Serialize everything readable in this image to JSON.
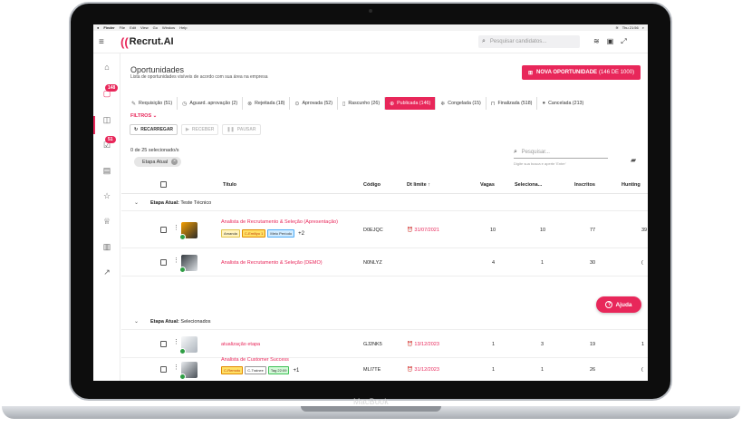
{
  "device": {
    "label": "MacBook"
  },
  "macbar": {
    "items": [
      "Finder",
      "File",
      "Edit",
      "View",
      "Go",
      "Window",
      "Help"
    ],
    "clock": "Thu 21:56"
  },
  "header": {
    "logo_text": "Recrut.AI",
    "search_placeholder": "Pesquisar candidatos..."
  },
  "sidebar": {
    "badges": [
      "148",
      "51"
    ]
  },
  "page": {
    "title": "Oportunidades",
    "subtitle": "Lista de oportunidades visíveis de acordo com sua área na empresa",
    "new_button": "NOVA OPORTUNIDADE",
    "new_button_count": "(146 DE 1000)"
  },
  "tabs": [
    {
      "label": "Requisição (51)",
      "icon": "edit-icon"
    },
    {
      "label": "Aguard. aprovação (2)",
      "icon": "clock-icon"
    },
    {
      "label": "Rejeitada (18)",
      "icon": "x-circle-icon"
    },
    {
      "label": "Aprovada (52)",
      "icon": "check-circle-icon"
    },
    {
      "label": "Rascunho (26)",
      "icon": "doc-icon"
    },
    {
      "label": "Publicada (146)",
      "icon": "globe-icon",
      "selected": true
    },
    {
      "label": "Congelada (15)",
      "icon": "snowflake-icon"
    },
    {
      "label": "Finalizada (518)",
      "icon": "lock-icon"
    },
    {
      "label": "Cancelada (213)",
      "icon": "cancel-icon"
    }
  ],
  "filters_label": "FILTROS",
  "actions": {
    "reload": "RECARREGAR",
    "receive": "RECEBER",
    "pause": "PAUSAR"
  },
  "selection": {
    "info": "0 de 25 selecionado/s",
    "chip": "Etapa Atual"
  },
  "panel_search": {
    "placeholder": "Pesquisar...",
    "hint": "Digite sua busca e aperte 'Enter'"
  },
  "table": {
    "headers": [
      "Título",
      "Código",
      "Dt limite ↑",
      "Vagas",
      "Seleciona...",
      "Inscritos",
      "Hunting"
    ],
    "group_prefix": "Etapa Atual:",
    "groups": [
      {
        "name": "Teste Técnico"
      },
      {
        "name": "Selecionados"
      }
    ],
    "rows": [
      {
        "title": "Analista de Recrutamento & Seleção (Apresentação)",
        "code": "D0EJQC",
        "date": "31/07/2021",
        "vagas": "10",
        "selecionados": "10",
        "inscritos": "77",
        "hunting": "39",
        "tags": [
          "Amanda",
          "C-Emiliyo 1",
          "Meio Período"
        ],
        "more": "+2"
      },
      {
        "title": "Analista de Recrutamento & Seleção (DEMO)",
        "code": "N0NLYZ",
        "date": "",
        "vagas": "4",
        "selecionados": "1",
        "inscritos": "30",
        "hunting": "("
      },
      {
        "title": "atualização etapa",
        "code": "GJ2NK5",
        "date": "13/12/2023",
        "vagas": "1",
        "selecionados": "3",
        "inscritos": "19",
        "hunting": "1"
      },
      {
        "title": "Analista de Customer Success",
        "code": "MLI7TE",
        "date": "31/12/2023",
        "vagas": "1",
        "selecionados": "1",
        "inscritos": "26",
        "hunting": "(",
        "tags": [
          "C-Remoto",
          "C-Trainee",
          "Tag 22:09"
        ],
        "more": "+1"
      }
    ]
  },
  "help_button": "Ajuda",
  "colors": {
    "brand": "#e8275a",
    "play": "#2f9e44"
  }
}
